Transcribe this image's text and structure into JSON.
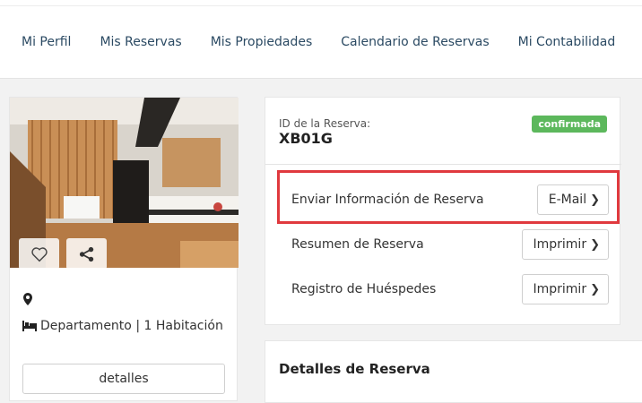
{
  "nav": {
    "items": [
      {
        "label": "Mi Perfil"
      },
      {
        "label": "Mis Reservas"
      },
      {
        "label": "Mis Propiedades"
      },
      {
        "label": "Calendario de Reservas"
      },
      {
        "label": "Mi Contabilidad"
      }
    ]
  },
  "property": {
    "favorite_icon": "heart-icon",
    "share_icon": "share-icon",
    "location_icon": "map-pin-icon",
    "type_icon": "bed-icon",
    "type_text": "Departamento | 1 Habitación",
    "details_button": "detalles"
  },
  "reservation": {
    "id_label": "ID de la Reserva:",
    "id_value": "XB01G",
    "status": "confirmada",
    "status_color": "#5cb85c",
    "rows": [
      {
        "label": "Enviar Información de Reserva",
        "button": "E-Mail"
      },
      {
        "label": "Resumen de Reserva",
        "button": "Imprimir"
      },
      {
        "label": "Registro de Huéspedes",
        "button": "Imprimir"
      }
    ],
    "highlight_color": "#e0393e"
  },
  "details": {
    "heading": "Detalles de Reserva"
  }
}
